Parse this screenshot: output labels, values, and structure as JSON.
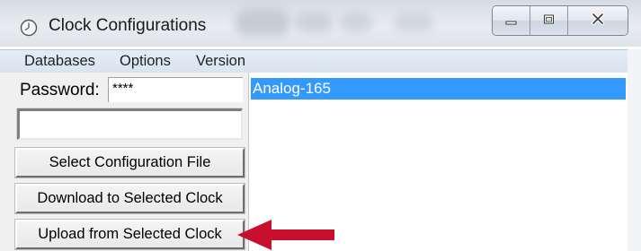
{
  "window": {
    "title": "Clock Configurations",
    "icon": "clock-icon"
  },
  "caption_buttons": [
    "minimize-icon",
    "maximize-icon",
    "close-icon"
  ],
  "menubar": {
    "items": [
      {
        "label": "Databases"
      },
      {
        "label": "Options"
      },
      {
        "label": "Version"
      }
    ]
  },
  "left_panel": {
    "password_label": "Password:",
    "password_value": "****",
    "text_field_value": "",
    "buttons": [
      {
        "label": "Select Configuration File"
      },
      {
        "label": "Download to Selected Clock"
      },
      {
        "label": "Upload from Selected Clock"
      }
    ]
  },
  "clock_list": {
    "items": [
      {
        "label": "Analog-165",
        "selected": true
      }
    ]
  },
  "annotation": {
    "icon": "red-arrow-icon",
    "color": "#c8102e"
  },
  "colors": {
    "selection": "#3399ff",
    "menubar": "#dde6f2",
    "panel": "#f0f0f0"
  }
}
